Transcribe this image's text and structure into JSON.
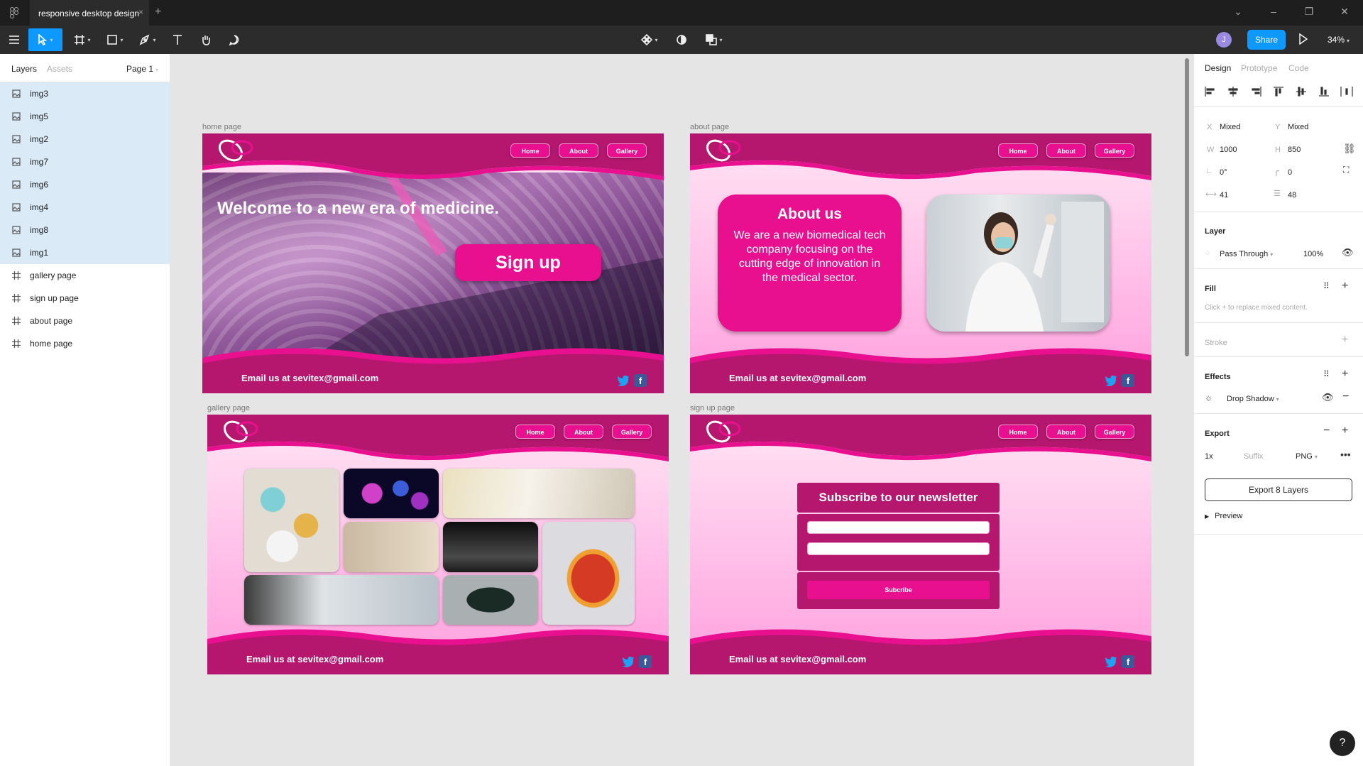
{
  "window": {
    "tab_title": "responsive desktop design",
    "tab_close": "×",
    "tab_add": "+"
  },
  "toolbar": {
    "avatar_initial": "J",
    "share_label": "Share",
    "zoom_label": "34%",
    "tools": [
      "move-tool",
      "frame-tool",
      "shape-tool",
      "pen-tool",
      "text-tool",
      "hand-tool",
      "comment-tool",
      "components-tool",
      "theme-tool",
      "boolean-tool"
    ]
  },
  "left_panel": {
    "tabs": [
      "Layers",
      "Assets"
    ],
    "page_selector": "Page 1",
    "layers": [
      {
        "name": "img3",
        "type": "image",
        "selected": true
      },
      {
        "name": "img5",
        "type": "image",
        "selected": true
      },
      {
        "name": "img2",
        "type": "image",
        "selected": true
      },
      {
        "name": "img7",
        "type": "image",
        "selected": true
      },
      {
        "name": "img6",
        "type": "image",
        "selected": true
      },
      {
        "name": "img4",
        "type": "image",
        "selected": true
      },
      {
        "name": "img8",
        "type": "image",
        "selected": true
      },
      {
        "name": "img1",
        "type": "image",
        "selected": true
      },
      {
        "name": "gallery page",
        "type": "frame",
        "selected": false
      },
      {
        "name": "sign up page",
        "type": "frame",
        "selected": false
      },
      {
        "name": "about page",
        "type": "frame",
        "selected": false
      },
      {
        "name": "home page",
        "type": "frame",
        "selected": false
      }
    ]
  },
  "canvas": {
    "nav": {
      "home": "Home",
      "about": "About",
      "gallery": "Gallery"
    },
    "footer_email": "Email us at sevitex@gmail.com",
    "footer_fb": "f",
    "home": {
      "label": "home page",
      "title": "Welcome to a new era of medicine.",
      "signup_button": "Sign up"
    },
    "about": {
      "label": "about page",
      "heading": "About us",
      "body": "We are a new biomedical tech company focusing on the cutting edge of innovation in the medical sector."
    },
    "gallery": {
      "label": "gallery page"
    },
    "signup": {
      "label": "sign up page",
      "newsletter_title": "Subscribe to our newsletter",
      "subscribe_button": "Subcribe"
    }
  },
  "right_panel": {
    "tabs": [
      "Design",
      "Prototype",
      "Code"
    ],
    "x_label": "X",
    "x_value": "Mixed",
    "y_label": "Y",
    "y_value": "Mixed",
    "w_label": "W",
    "w_value": "1000",
    "h_label": "H",
    "h_value": "850",
    "rotation": "0°",
    "radius": "0",
    "spacing_h": "41",
    "spacing_v": "48",
    "layer_title": "Layer",
    "blend_mode": "Pass Through",
    "opacity": "100%",
    "fill_title": "Fill",
    "fill_hint": "Click + to replace mixed content.",
    "stroke_title": "Stroke",
    "effects_title": "Effects",
    "effect_name": "Drop Shadow",
    "export_title": "Export",
    "export_scale": "1x",
    "export_suffix_placeholder": "Suffix",
    "export_format": "PNG",
    "export_button": "Export 8 Layers",
    "preview_label": "Preview"
  },
  "help_label": "?",
  "colors": {
    "brand_pink": "#e8108f",
    "header_magenta": "#b5176e",
    "figma_blue": "#0d99ff"
  }
}
